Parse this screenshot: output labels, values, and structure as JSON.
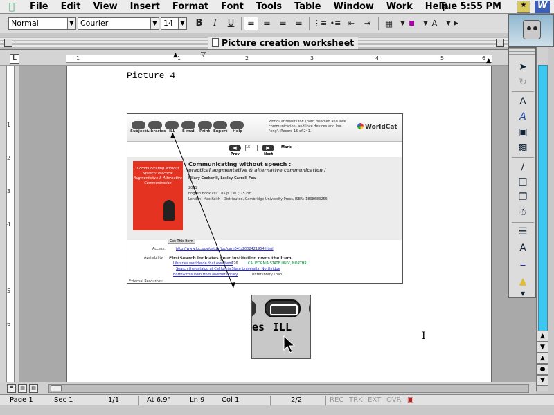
{
  "menubar": {
    "items": [
      "File",
      "Edit",
      "View",
      "Insert",
      "Format",
      "Font",
      "Tools",
      "Table",
      "Window",
      "Work",
      "Help"
    ],
    "clock": "Tue 5:55 PM",
    "app_letter": "W"
  },
  "toolbar": {
    "style": "Normal",
    "font": "Courier",
    "size": "14",
    "bold": "B",
    "italic": "I",
    "underline": "U"
  },
  "window": {
    "title": "Picture creation worksheet"
  },
  "ruler": {
    "numbers": [
      "1",
      "1",
      "2",
      "3",
      "4",
      "5",
      "6"
    ]
  },
  "vruler": {
    "numbers": [
      "1",
      "2",
      "3",
      "4",
      "5",
      "6"
    ]
  },
  "document": {
    "heading": "Picture 4",
    "screenshot": {
      "buttons": [
        "Subjects",
        "Libraries",
        "ILL",
        "E-mail",
        "Print",
        "Export",
        "Help"
      ],
      "wc_info": "WorldCat results for: (both disabled and love communication) and love devices and ln= \"eng\". Record 15 of 241.",
      "wc_logo": "WorldCat",
      "nav": {
        "prev": "Prev",
        "next": "Next",
        "record": "15",
        "mark": "Mark:"
      },
      "cover_text": "Communicating Without Speech: Practical Augmentative & Alternative Communication",
      "title": "Communicating without speech :",
      "subtitle": "practical augmentative & alternative communication /",
      "authors": "Hilary Cockerill, Lesley Carroll-Few",
      "year": "2001",
      "lang": "English  Book viii, 185 p. : ill. ; 25 cm.",
      "publisher": "London: Mac Keith : Distributed, Cambridge University Press, ISBN: 1898683255",
      "get_this": "Get This Item",
      "access_label": "Access:",
      "access_url": "http://www.loc.gov/catdir/toc/cam041/2002421954.html",
      "availability_label": "Availability:",
      "availability_text": "FirstSearch indicates your institution owns the item.",
      "libs_link": "Libraries worldwide that own item:",
      "libs_count": "176",
      "csun": "CALIFORNIA STATE UNIV, NORTHRI",
      "catalog_link": "Search the catalog at California State University, Northridge",
      "borrow_link": "Borrow this item from another library",
      "borrow_suffix": "(Interlibrary Loan)",
      "external_label": "External Resources:"
    },
    "zoom": {
      "label": "ILL",
      "partial": "es"
    }
  },
  "statusbar": {
    "page": "Page 1",
    "sec": "Sec 1",
    "pages": "1/1",
    "at": "At 6.9\"",
    "ln": "Ln 9",
    "col": "Col 1",
    "count": "2/2",
    "rec": "REC",
    "trk": "TRK",
    "ext": "EXT",
    "ovr": "OVR"
  },
  "colors": {
    "scroll_track": "#3cc8ee",
    "cover_red": "#e53322",
    "link_blue": "#2222cc"
  }
}
